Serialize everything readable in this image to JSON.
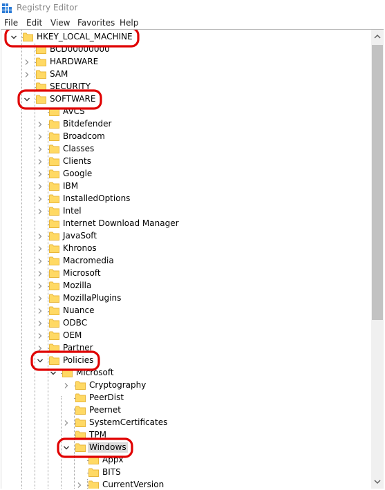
{
  "window": {
    "title": "Registry Editor"
  },
  "menu": [
    "File",
    "Edit",
    "View",
    "Favorites",
    "Help"
  ],
  "colors": {
    "folder_fill": "#ffd964",
    "folder_tab": "#e8b63a",
    "annotation": "#e00000",
    "selection": "#dcdcdc"
  },
  "tree": [
    {
      "label": "HKEY_LOCAL_MACHINE",
      "level": 1,
      "expander": "expanded",
      "highlight": true
    },
    {
      "label": "BCD00000000",
      "level": 2,
      "expander": "none"
    },
    {
      "label": "HARDWARE",
      "level": 2,
      "expander": "collapsed"
    },
    {
      "label": "SAM",
      "level": 2,
      "expander": "collapsed"
    },
    {
      "label": "SECURITY",
      "level": 2,
      "expander": "none"
    },
    {
      "label": "SOFTWARE",
      "level": 2,
      "expander": "expanded",
      "highlight": true
    },
    {
      "label": "AVCS",
      "level": 3,
      "expander": "none"
    },
    {
      "label": "Bitdefender",
      "level": 3,
      "expander": "collapsed"
    },
    {
      "label": "Broadcom",
      "level": 3,
      "expander": "collapsed"
    },
    {
      "label": "Classes",
      "level": 3,
      "expander": "collapsed"
    },
    {
      "label": "Clients",
      "level": 3,
      "expander": "collapsed"
    },
    {
      "label": "Google",
      "level": 3,
      "expander": "collapsed"
    },
    {
      "label": "IBM",
      "level": 3,
      "expander": "collapsed"
    },
    {
      "label": "InstalledOptions",
      "level": 3,
      "expander": "collapsed"
    },
    {
      "label": "Intel",
      "level": 3,
      "expander": "collapsed"
    },
    {
      "label": "Internet Download Manager",
      "level": 3,
      "expander": "none"
    },
    {
      "label": "JavaSoft",
      "level": 3,
      "expander": "collapsed"
    },
    {
      "label": "Khronos",
      "level": 3,
      "expander": "collapsed"
    },
    {
      "label": "Macromedia",
      "level": 3,
      "expander": "collapsed"
    },
    {
      "label": "Microsoft",
      "level": 3,
      "expander": "collapsed"
    },
    {
      "label": "Mozilla",
      "level": 3,
      "expander": "collapsed"
    },
    {
      "label": "MozillaPlugins",
      "level": 3,
      "expander": "collapsed"
    },
    {
      "label": "Nuance",
      "level": 3,
      "expander": "collapsed"
    },
    {
      "label": "ODBC",
      "level": 3,
      "expander": "collapsed"
    },
    {
      "label": "OEM",
      "level": 3,
      "expander": "collapsed"
    },
    {
      "label": "Partner",
      "level": 3,
      "expander": "collapsed"
    },
    {
      "label": "Policies",
      "level": 3,
      "expander": "expanded",
      "highlight": true
    },
    {
      "label": "Microsoft",
      "level": 4,
      "expander": "expanded"
    },
    {
      "label": "Cryptography",
      "level": 5,
      "expander": "collapsed"
    },
    {
      "label": "PeerDist",
      "level": 5,
      "expander": "none"
    },
    {
      "label": "Peernet",
      "level": 5,
      "expander": "none"
    },
    {
      "label": "SystemCertificates",
      "level": 5,
      "expander": "collapsed"
    },
    {
      "label": "TPM",
      "level": 5,
      "expander": "none"
    },
    {
      "label": "Windows",
      "level": 5,
      "expander": "expanded",
      "highlight": true,
      "selected": true
    },
    {
      "label": "Appx",
      "level": 6,
      "expander": "none"
    },
    {
      "label": "BITS",
      "level": 6,
      "expander": "none"
    },
    {
      "label": "CurrentVersion",
      "level": 6,
      "expander": "collapsed"
    }
  ]
}
